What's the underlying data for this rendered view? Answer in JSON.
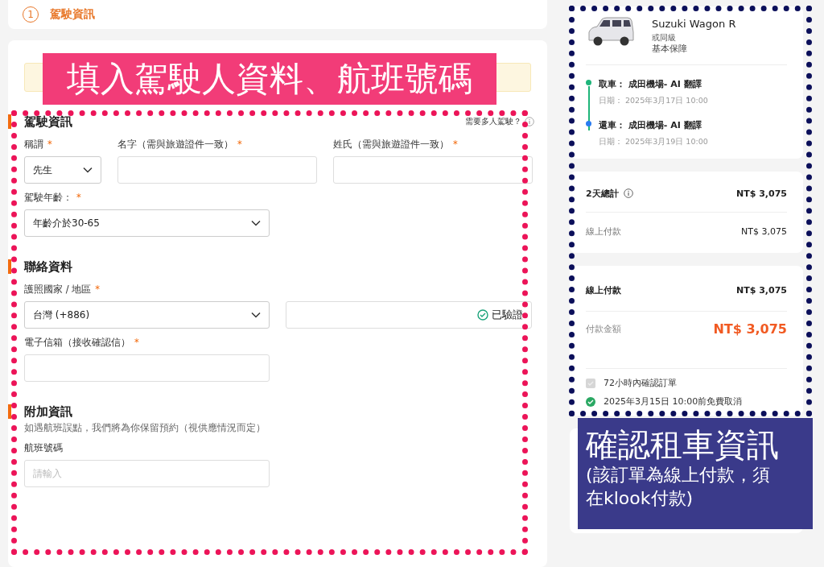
{
  "step": {
    "number": "1",
    "title": "駕駛資訊"
  },
  "sections": [
    {
      "title": "駕駛資訊",
      "aside": "需要多人駕駛？",
      "rows": [
        [
          {
            "kind": "select",
            "label": "稱謂",
            "required_mark": "*",
            "value": "先生"
          },
          {
            "kind": "input",
            "label": "名字（需與旅遊證件一致）",
            "required_mark": "*"
          },
          {
            "kind": "input",
            "label": "姓氏（需與旅遊證件一致）",
            "required_mark": "*"
          }
        ],
        [
          {
            "kind": "select",
            "label": "駕駛年齡：",
            "required_mark": "*",
            "value": "年齡介於30-65"
          }
        ]
      ]
    },
    {
      "title": "聯絡資料",
      "rows": [
        [
          {
            "kind": "select",
            "label": "護照國家 / 地區",
            "required_mark": "*",
            "value": "台灣 (+886)"
          },
          {
            "kind": "verified",
            "badge": "已驗證"
          }
        ],
        [
          {
            "kind": "input",
            "label": "電子信箱（接收確認信）",
            "required_mark": "*"
          }
        ]
      ]
    },
    {
      "title": "附加資訊",
      "note": "如遇航班誤點，我們將為你保留預約（視供應情況而定）",
      "rows": [
        [
          {
            "kind": "input",
            "label": "航班號碼",
            "placeholder": "請輸入"
          }
        ]
      ]
    }
  ],
  "car": {
    "name": "Suzuki Wagon R",
    "class": "或同級",
    "insurance": "基本保障",
    "stops": [
      {
        "title": "取車： 成田機場- AI 翻譯",
        "date": "日期： 2025年3月17日 10:00",
        "color": "#1fb57a"
      },
      {
        "title": "還車： 成田機場- AI 翻譯",
        "date": "日期： 2025年3月19日 10:00",
        "color": "#2a7cf0"
      }
    ]
  },
  "summary": [
    {
      "label": "2天總計",
      "value": "NT$ 3,075",
      "emphasis": true,
      "info": true
    },
    {
      "label": "線上付款",
      "value": "NT$ 3,075",
      "emphasis": false
    }
  ],
  "payment": {
    "rows": [
      {
        "label": "線上付款",
        "value": "NT$ 3,075",
        "kind": "plain"
      },
      {
        "label": "付款金額",
        "value": "NT$ 3,075",
        "kind": "total"
      }
    ],
    "features": [
      {
        "text": "72小時內確認訂單",
        "kind": "pending"
      },
      {
        "text": "2025年3月15日 10:00前免費取消",
        "kind": "ok"
      }
    ]
  },
  "annotations": [
    {
      "kind": "pink",
      "lines": [
        "填入駕駛人資料、航班號碼"
      ]
    },
    {
      "kind": "navy",
      "lines": [
        "確認租車資訊",
        "(該訂單為線上付款，須在klook付款)"
      ]
    }
  ]
}
